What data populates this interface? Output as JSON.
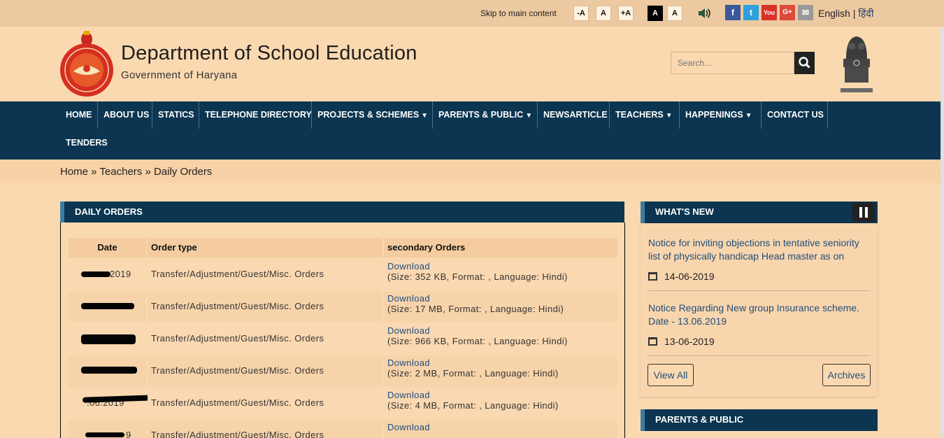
{
  "topbar": {
    "skip_link": "Skip to main content",
    "font_controls": [
      "-A",
      "A",
      "+A"
    ],
    "contrast_controls": [
      "A",
      "A"
    ],
    "social": [
      {
        "name": "facebook",
        "glyph": "f",
        "color": "#3b5998"
      },
      {
        "name": "twitter",
        "glyph": "t",
        "color": "#2ea1dc"
      },
      {
        "name": "youtube",
        "glyph": "You",
        "color": "#d9302a"
      },
      {
        "name": "google-plus",
        "glyph": "G+",
        "color": "#dd4b39"
      },
      {
        "name": "email",
        "glyph": "✉",
        "color": "#9a9a9a"
      }
    ],
    "lang_english": "English",
    "lang_sep": "|",
    "lang_hindi": "हिंदी"
  },
  "header": {
    "title": "Department of School Education",
    "subtitle": "Government of Haryana",
    "search_placeholder": "Search..."
  },
  "nav": {
    "items": [
      "HOME",
      "ABOUT US",
      "STATICS",
      "TELEPHONE DIRECTORY",
      "PROJECTS & SCHEMES",
      "PARENTS & PUBLIC",
      "NEWSARTICLE",
      "TEACHERS",
      "HAPPENINGS",
      "CONTACT US",
      "TENDERS"
    ]
  },
  "breadcrumb": "Home » Teachers » Daily Orders",
  "main": {
    "heading": "DAILY ORDERS",
    "columns": [
      "Date",
      "Order type",
      "secondary Orders"
    ],
    "rows": [
      {
        "date": "2019",
        "type": "Transfer/Adjustment/Guest/Misc. Orders",
        "link": "Download",
        "meta": "(Size: 352 KB, Format: , Language: Hindi)"
      },
      {
        "date": "",
        "type": "Transfer/Adjustment/Guest/Misc. Orders",
        "link": "Download",
        "meta": "(Size: 17 MB, Format: , Language: Hindi)"
      },
      {
        "date": "",
        "type": "Transfer/Adjustment/Guest/Misc. Orders",
        "link": "Download",
        "meta": "(Size: 966 KB, Format: , Language: Hindi)"
      },
      {
        "date": "",
        "type": "Transfer/Adjustment/Guest/Misc. Orders",
        "link": "Download",
        "meta": "(Size: 2 MB, Format: , Language: Hindi)"
      },
      {
        "date": ".06.2019",
        "type": "Transfer/Adjustment/Guest/Misc. Orders",
        "link": "Download",
        "meta": "(Size: 4 MB, Format: , Language: Hindi)"
      },
      {
        "date": "9",
        "type": "Transfer/Adjustment/Guest/Misc. Orders",
        "link": "Download",
        "meta": ""
      }
    ]
  },
  "whats_new": {
    "heading": "WHAT'S NEW",
    "items": [
      {
        "text": "Notice for inviting objections in tentative seniority list of physically handicap Head master as on",
        "date": "14-06-2019"
      },
      {
        "text": "Notice Regarding New group Insurance scheme. Date - 13.06.2019",
        "date": "13-06-2019"
      }
    ],
    "view_all": "View All",
    "archives": "Archives"
  },
  "parents_public": {
    "heading": "PARENTS & PUBLIC"
  }
}
